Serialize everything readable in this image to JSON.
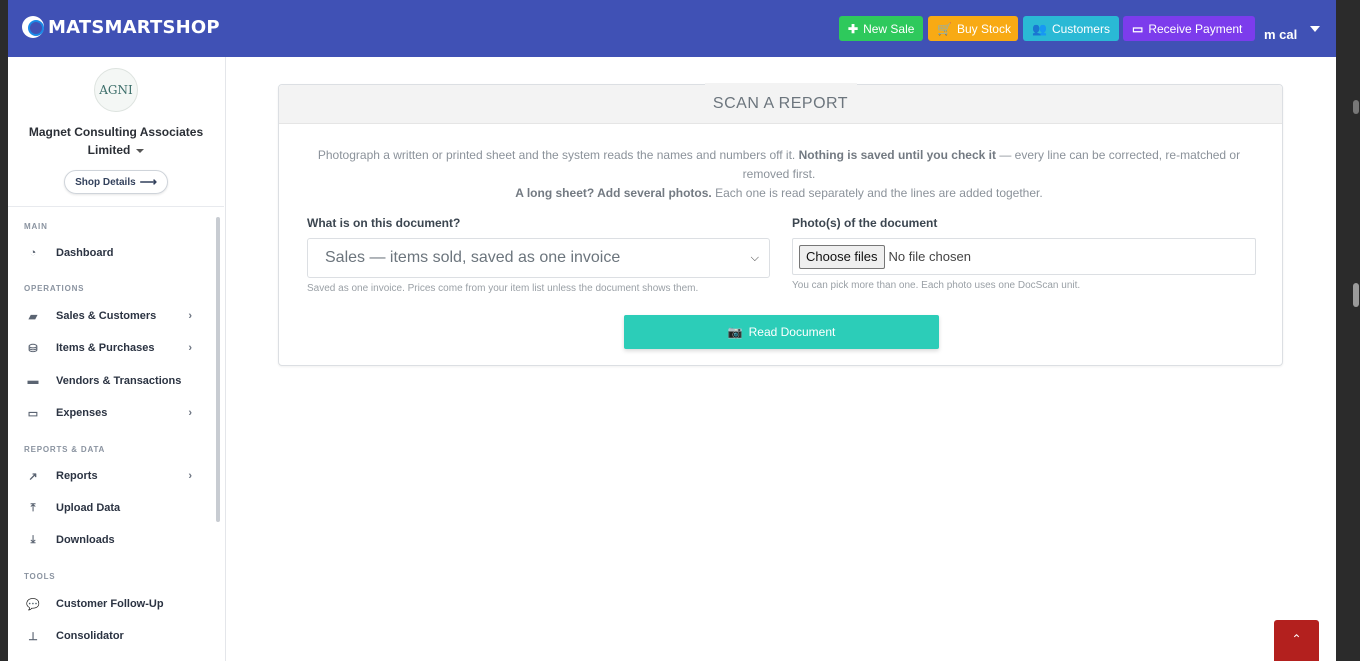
{
  "brand": {
    "name": "MATSMARTSHOP"
  },
  "topbar": {
    "buttons": [
      {
        "label": "New Sale",
        "icon": "plus-icon",
        "color": "#2ec95c"
      },
      {
        "label": "Buy Stock",
        "icon": "cart-icon",
        "color": "#f8aa14"
      },
      {
        "label": "Customers",
        "icon": "users-icon",
        "color": "#2ab9d5"
      },
      {
        "label": "Receive Payment",
        "icon": "credit-card-icon",
        "color": "#7c3cec"
      }
    ],
    "user": "m cal"
  },
  "sidebar": {
    "company_logo_text": "AGNI",
    "company_name_line1": "Magnet Consulting Associates",
    "company_name_line2": "Limited",
    "shop_details": "Shop Details",
    "sections": [
      {
        "label": "MAIN",
        "items": [
          {
            "label": "Dashboard",
            "icon": "dashboard-icon",
            "has_submenu": false
          }
        ]
      },
      {
        "label": "OPERATIONS",
        "items": [
          {
            "label": "Sales & Customers",
            "icon": "bag-icon",
            "has_submenu": true
          },
          {
            "label": "Items & Purchases",
            "icon": "boxes-icon",
            "has_submenu": true
          },
          {
            "label": "Vendors & Transactions",
            "icon": "truck-icon",
            "has_submenu": false
          },
          {
            "label": "Expenses",
            "icon": "card-icon",
            "has_submenu": true
          }
        ]
      },
      {
        "label": "REPORTS & DATA",
        "items": [
          {
            "label": "Reports",
            "icon": "chart-line-icon",
            "has_submenu": true
          },
          {
            "label": "Upload Data",
            "icon": "upload-icon",
            "has_submenu": false
          },
          {
            "label": "Downloads",
            "icon": "download-icon",
            "has_submenu": false
          }
        ]
      },
      {
        "label": "TOOLS",
        "items": [
          {
            "label": "Customer Follow-Up",
            "icon": "chat-icon",
            "has_submenu": false
          },
          {
            "label": "Consolidator",
            "icon": "sitemap-icon",
            "has_submenu": false
          }
        ]
      }
    ]
  },
  "main": {
    "card_title": "SCAN A REPORT",
    "intro_part1": "Photograph a written or printed sheet and the system reads the names and numbers off it.",
    "intro_bold1": "Nothing is saved until you check it",
    "intro_part2": "— every line can be corrected, re-matched or removed first.",
    "intro_bold2": "A long sheet? Add several photos.",
    "intro_part3": "Each one is read separately and the lines are added together.",
    "doc_type_label": "What is on this document?",
    "doc_type_value": "Sales — items sold, saved as one invoice",
    "doc_type_help": "Saved as one invoice. Prices come from your item list unless the document shows them.",
    "photos_label": "Photo(s) of the document",
    "file_button": "Choose files",
    "file_status": "No file chosen",
    "photos_help": "You can pick more than one. Each photo uses one DocScan unit.",
    "read_button": "Read Document"
  }
}
